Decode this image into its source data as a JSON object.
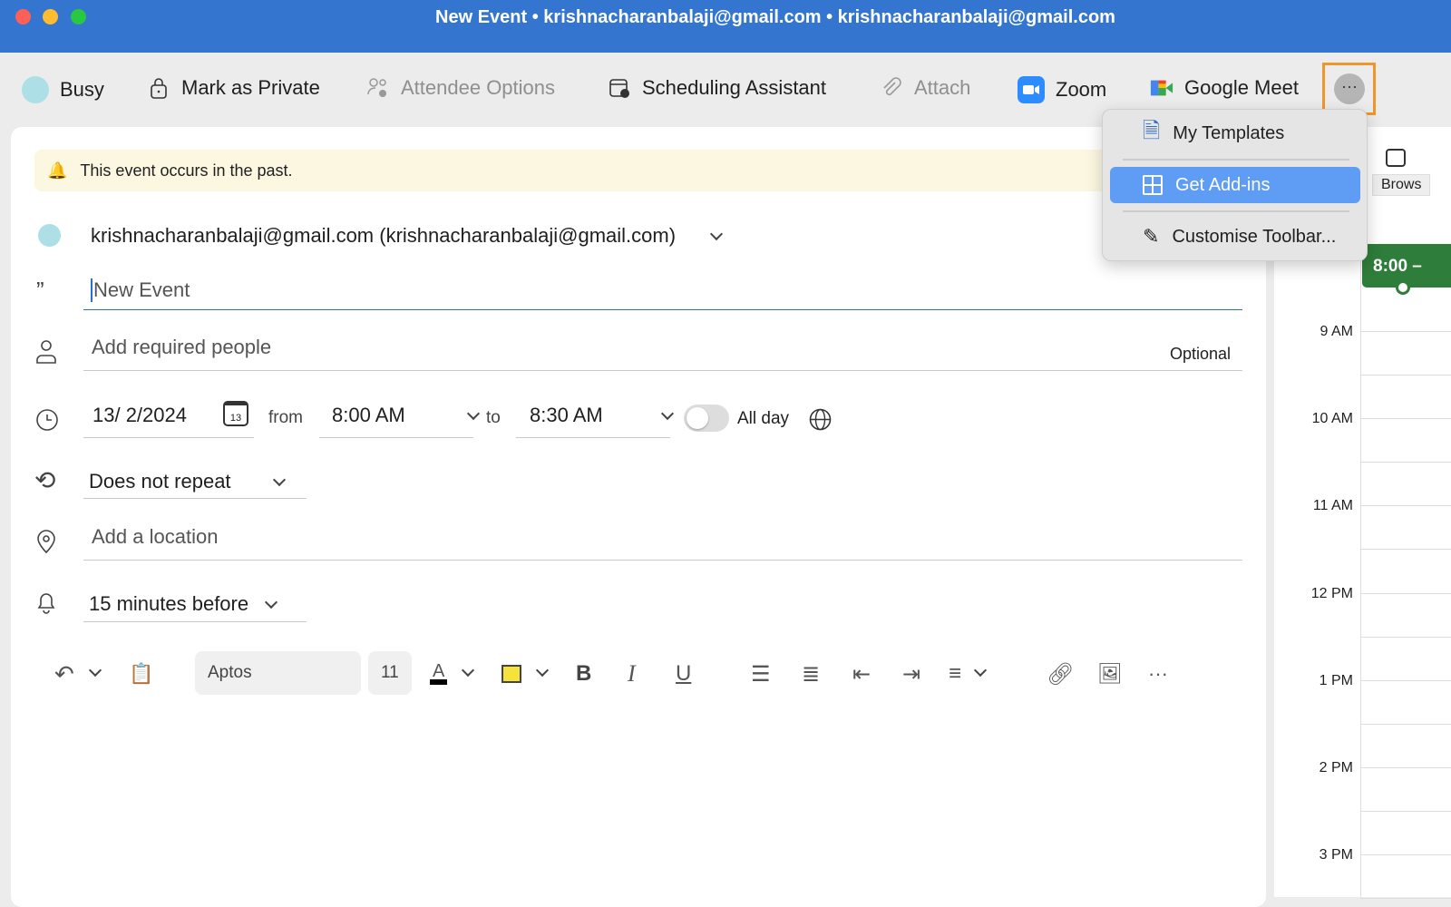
{
  "window": {
    "title": "New Event • krishnacharanbalaji@gmail.com • krishnacharanbalaji@gmail.com"
  },
  "toolbar": {
    "busy": "Busy",
    "private": "Mark as Private",
    "attendee": "Attendee Options",
    "scheduling": "Scheduling Assistant",
    "attach": "Attach",
    "zoom": "Zoom",
    "meet": "Google Meet",
    "more": "···"
  },
  "menu": {
    "items": [
      {
        "label": "My Templates",
        "icon": "template-icon"
      },
      {
        "label": "Get Add-ins",
        "icon": "add-ins-icon",
        "selected": true
      },
      {
        "label": "Customise Toolbar...",
        "icon": "pen-icon"
      }
    ]
  },
  "banner": {
    "text": "This event occurs in the past."
  },
  "form": {
    "calendar": "krishnacharanbalaji@gmail.com (krishnacharanbalaji@gmail.com)",
    "title_value": "New Event",
    "people_placeholder": "Add required people",
    "optional": "Optional",
    "date": "13/ 2/2024",
    "date_icon": "13",
    "from": "from",
    "start": "8:00 AM",
    "to": "to",
    "end": "8:30 AM",
    "allday": "All day",
    "allday_on": false,
    "repeat": "Does not repeat",
    "location_placeholder": "Add a location",
    "reminder": "15 minutes before"
  },
  "format": {
    "font": "Aptos",
    "size": "11",
    "bold": "B",
    "italic": "I",
    "underline": "U",
    "more": "···"
  },
  "calendar": {
    "browse": "Brows",
    "event": "8:00 –",
    "hours": [
      "9 AM",
      "10 AM",
      "11 AM",
      "12 PM",
      "1 PM",
      "2 PM",
      "3 PM"
    ],
    "event_color": "#2e7d3a"
  },
  "colors": {
    "titlebar": "#3476cf",
    "highlight": "#f0962a",
    "selected": "#5f9cf4",
    "busy": "#acdfe6"
  }
}
